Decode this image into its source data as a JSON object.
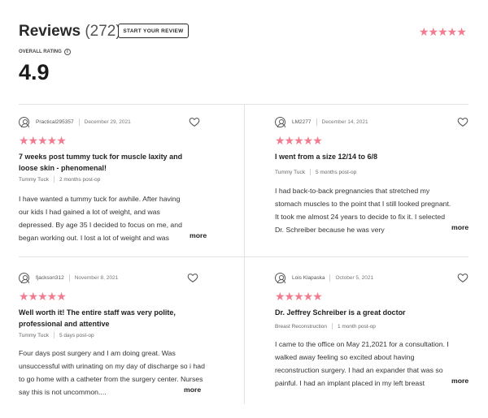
{
  "header": {
    "title": "Reviews",
    "count": "(272)",
    "start_button": "START YOUR REVIEW",
    "stars": "★★★★★",
    "overall_label": "OVERALL RATING",
    "info_icon": "i",
    "score": "4.9"
  },
  "reviews": [
    {
      "username": "Practical295357",
      "date": "December 29, 2021",
      "stars": "★★★★★",
      "headline": "7 weeks post tummy tuck for muscle laxity and loose skin - phenomenal!",
      "procedure": "Tummy Tuck",
      "timing": "2 months post-op",
      "body": "I have wanted a tummy tuck for awhile. After having our kids I had gained a lot of weight, and was depressed. By age 35 I decided to focus on me, and began working out. I lost a lot of weight and was",
      "more": "more"
    },
    {
      "username": "LM2277",
      "date": "December 14, 2021",
      "stars": "★★★★★",
      "headline": "I went from a size 12/14 to 6/8",
      "procedure": "Tummy Tuck",
      "timing": "5 months post-op",
      "body": "I had back-to-back pregnancies that stretched my stomach muscles to the point that I still looked pregnant. It took me almost 24 years to decide to fix it. I selected Dr. Schreiber because he was very",
      "more": "more"
    },
    {
      "username": "fjackson312",
      "date": "November 8, 2021",
      "stars": "★★★★★",
      "headline": "Well worth it! The entire staff was very polite, professional and attentive",
      "procedure": "Tummy Tuck",
      "timing": "5 days post-op",
      "body": "Four days post surgery and I am doing great. Was unsuccessful with urinating on my day of discharge so i had to go home with a catheter from the surgery center. Nurses say this is not uncommon....",
      "more": "more"
    },
    {
      "username": "Lois Klapaska",
      "date": "October 5, 2021",
      "stars": "★★★★★",
      "headline": "Dr. Jeffrey Schreiber is a great doctor",
      "procedure": "Breast Reconstruction",
      "timing": "1 month post-op",
      "body": "I came to the office on May 21,2021 for a consultation. I walked away feeling so excited about having reconstruction surgery. I had an expander that was so painful. I had an implant placed in my left breast",
      "more": "more"
    }
  ]
}
